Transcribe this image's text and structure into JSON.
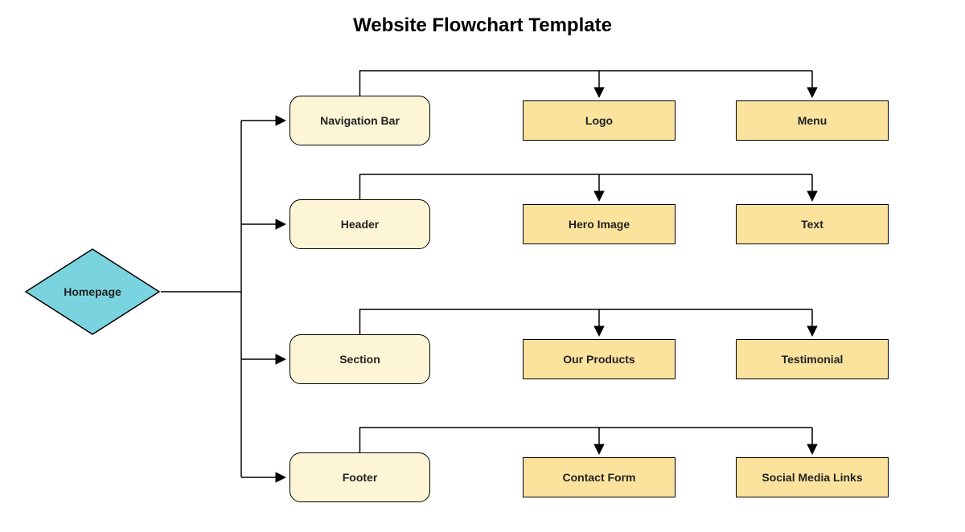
{
  "title": "Website Flowchart Template",
  "root": {
    "label": "Homepage"
  },
  "sections": [
    {
      "label": "Navigation Bar",
      "children": [
        "Logo",
        "Menu"
      ]
    },
    {
      "label": "Header",
      "children": [
        "Hero Image",
        "Text"
      ]
    },
    {
      "label": "Section",
      "children": [
        "Our Products",
        "Testimonial"
      ]
    },
    {
      "label": "Footer",
      "children": [
        "Contact Form",
        "Social Media Links"
      ]
    }
  ],
  "colors": {
    "diamond_fill": "#7ad4df",
    "rounded_fill": "#fdf6d6",
    "rect_fill": "#fbe39e",
    "stroke": "#000000"
  }
}
